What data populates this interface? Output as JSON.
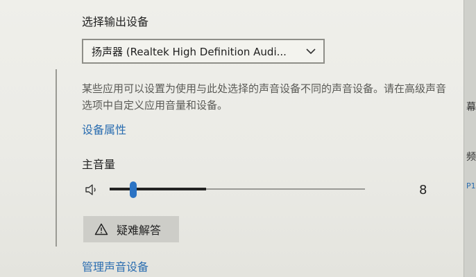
{
  "output": {
    "title": "选择输出设备",
    "selected_device": "扬声器 (Realtek High Definition Audi...",
    "hint": "某些应用可以设置为使用与此处选择的声音设备不同的声音设备。请在高级声音选项中自定义应用音量和设备。",
    "device_properties_link": "设备属性"
  },
  "volume": {
    "label": "主音量",
    "value": 8,
    "value_text": "8"
  },
  "troubleshoot": {
    "label": "疑难解答"
  },
  "manage_devices_link": "管理声音设备",
  "edge_fragments": [
    "幕",
    "频",
    "P1"
  ],
  "icons": {
    "dropdown": "chevron-down-icon",
    "speaker": "speaker-icon",
    "warning": "warning-icon"
  },
  "colors": {
    "accent": "#2b73c4",
    "link": "#2a6db0",
    "slider_filled": "#222222",
    "slider_track": "#9a9a96",
    "button_bg": "#cdcdc8"
  }
}
